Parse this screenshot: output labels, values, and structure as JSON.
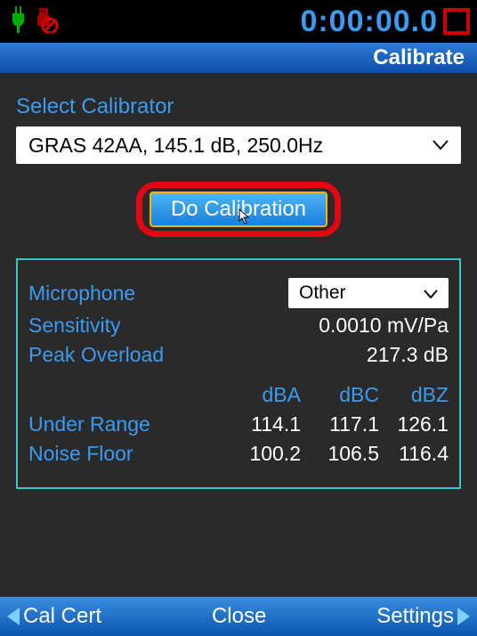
{
  "status": {
    "timer": "0:00:00.0"
  },
  "title": "Calibrate",
  "calibrator": {
    "label": "Select Calibrator",
    "selected": "GRAS 42AA, 145.1 dB, 250.0Hz"
  },
  "doCalBtn": "Do Calibration",
  "mic": {
    "label": "Microphone",
    "selected": "Other"
  },
  "sensitivity": {
    "label": "Sensitivity",
    "value": "0.0010 mV/Pa"
  },
  "peakOverload": {
    "label": "Peak Overload",
    "value": "217.3 dB"
  },
  "headers": {
    "c1": "dBA",
    "c2": "dBC",
    "c3": "dBZ"
  },
  "underRange": {
    "label": "Under Range",
    "c1": "114.1",
    "c2": "117.1",
    "c3": "126.1"
  },
  "noiseFloor": {
    "label": "Noise Floor",
    "c1": "100.2",
    "c2": "106.5",
    "c3": "116.4"
  },
  "bottom": {
    "left": "Cal Cert",
    "center": "Close",
    "right": "Settings"
  }
}
